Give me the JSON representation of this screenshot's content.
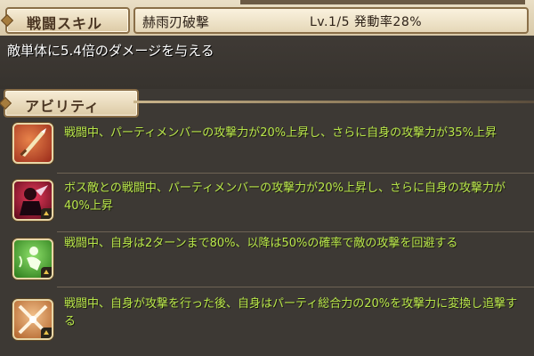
{
  "skill": {
    "tab_label": "戦闘スキル",
    "name": "赫雨刃破撃",
    "level_rate": "Lv.1/5 発動率28%",
    "description": "敵単体に5.4倍のダメージを与える"
  },
  "abilities": {
    "tab_label": "アビリティ",
    "items": [
      {
        "icon": "sword-icon",
        "text": "戦闘中、パーティメンバーの攻撃力が20%上昇し、さらに自身の攻撃力が35%上昇",
        "color": "#b8e64a"
      },
      {
        "icon": "boss-attack-icon",
        "text": "ボス敵との戦闘中、パーティメンバーの攻撃力が20%上昇し、さらに自身の攻撃力が40%上昇",
        "color": "#b8e64a"
      },
      {
        "icon": "dodge-icon",
        "text": "戦闘中、自身は2ターンまで80%、以降は50%の確率で敵の攻撃を回避する",
        "color": "#b8e64a"
      },
      {
        "icon": "crossed-swords-icon",
        "text": "戦闘中、自身が攻撃を行った後、自身はパーティ総合力の20%を攻撃力に変換し追撃する",
        "color": "#b8e64a"
      }
    ]
  }
}
